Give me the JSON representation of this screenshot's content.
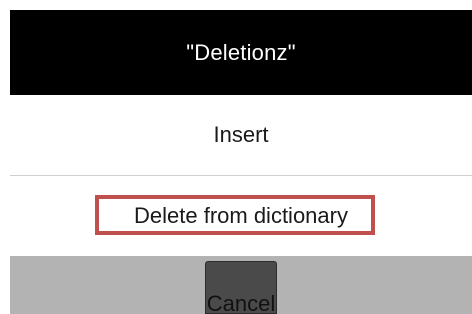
{
  "dialog": {
    "title": "\"Deletionz\"",
    "items": [
      {
        "label": "Insert"
      },
      {
        "label": "Delete from dictionary"
      }
    ],
    "cancel_label": "Cancel"
  },
  "colors": {
    "title_bg": "#000000",
    "title_text": "#ffffff",
    "highlight_border": "#c0504d",
    "footer_bg": "#b3b3b3",
    "cancel_bg": "#4a4a4a"
  }
}
